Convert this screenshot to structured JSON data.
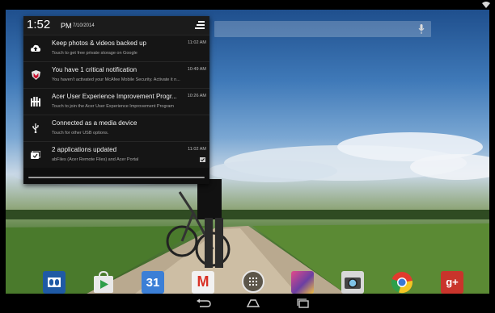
{
  "status_bar": {
    "wifi_icon": "wifi-icon"
  },
  "search": {
    "mic_icon": "mic-icon"
  },
  "shade": {
    "time": "1:52",
    "ampm": "PM",
    "date": "7/10/2014",
    "settings_icon": "quick-settings-icon",
    "notifications": [
      {
        "icon": "cloud-upload-icon",
        "title": "Keep photos & videos backed up",
        "text": "Touch to get free private storage on Google",
        "time": "11:02 AM"
      },
      {
        "icon": "mcafee-shield-icon",
        "title": "You have 1 critical notification",
        "text": "You haven't activated your McAfee Mobile Security. Activate it n...",
        "time": "10:49 AM"
      },
      {
        "icon": "acer-ux-icon",
        "title": "Acer User Experience Improvement Progr...",
        "text": "Touch to join the Acer User Experience Improvement Program",
        "time": "10:26 AM"
      },
      {
        "icon": "usb-icon",
        "title": "Connected as a media device",
        "text": "Touch for other USB options.",
        "time": ""
      },
      {
        "icon": "apps-updated-icon",
        "title": "2 applications updated",
        "text": "abFiles (Acer Remote Files) and Acer Portal",
        "time": "11:02 AM"
      }
    ]
  },
  "dock": {
    "apps": [
      {
        "name": "dolby-icon",
        "color": "#1f5aa5"
      },
      {
        "name": "play-store-icon",
        "color": "#e9e9e9"
      },
      {
        "name": "calendar-icon",
        "color": "#3b7fd6",
        "label": "31"
      },
      {
        "name": "gmail-icon",
        "color": "#f2f2f2",
        "label": "M"
      },
      {
        "name": "gallery-icon",
        "color": "#6b3fa3"
      },
      {
        "name": "camera-icon",
        "color": "#d8d8d8"
      },
      {
        "name": "chrome-icon",
        "color": "#e23b2e"
      },
      {
        "name": "google-plus-icon",
        "color": "#c9342b",
        "label": "g+"
      }
    ]
  },
  "nav": {
    "back_icon": "back-icon",
    "home_icon": "home-icon",
    "recents_icon": "recent-apps-icon"
  }
}
